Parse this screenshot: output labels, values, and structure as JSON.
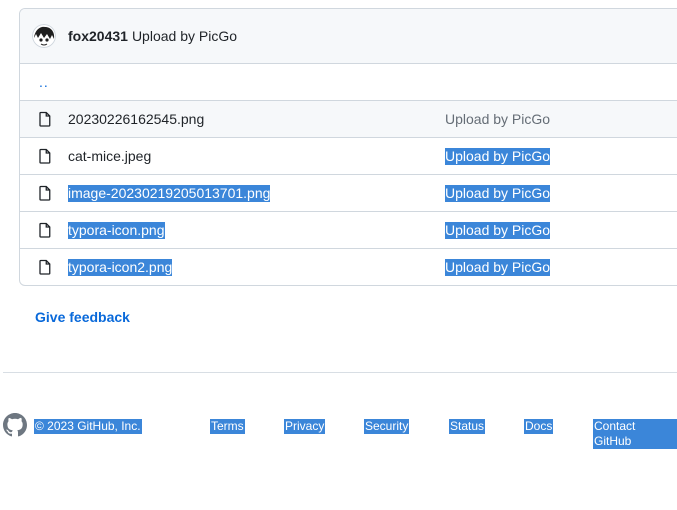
{
  "commit": {
    "author": "fox20431",
    "message": "Upload by PicGo"
  },
  "parent_dir": "..",
  "files": [
    {
      "name": "20230226162545.png",
      "message": "Upload by PicGo"
    },
    {
      "name": "cat-mice.jpeg",
      "message": "Upload by PicGo"
    },
    {
      "name": "image-20230219205013701.png",
      "message": "Upload by PicGo"
    },
    {
      "name": "typora-icon.png",
      "message": "Upload by PicGo"
    },
    {
      "name": "typora-icon2.png",
      "message": "Upload by PicGo"
    }
  ],
  "feedback_label": "Give feedback",
  "footer": {
    "copyright": "© 2023 GitHub, Inc.",
    "links": [
      "Terms",
      "Privacy",
      "Security",
      "Status",
      "Docs",
      "Contact GitHub"
    ]
  },
  "colors": {
    "selection": "#3b86d9",
    "link": "#0969da",
    "border": "#d0d7de"
  },
  "icons": [
    "avatar",
    "parent-directory",
    "file-icon",
    "github-logo-icon"
  ]
}
